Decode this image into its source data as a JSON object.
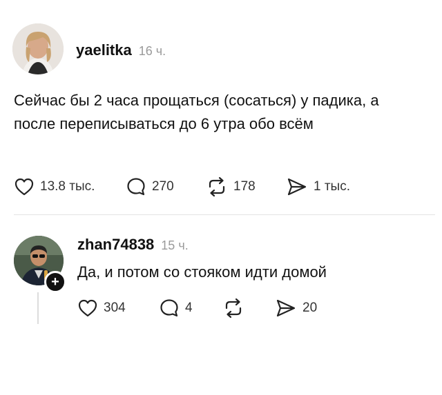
{
  "post": {
    "username": "yaelitka",
    "time": "16 ч.",
    "text": "Сейчас бы 2 часа прощаться (сосаться) у падика, а после переписываться до 6 утра обо всём",
    "likes": "13.8 тыс.",
    "comments": "270",
    "reposts": "178",
    "shares": "1 тыс."
  },
  "reply": {
    "username": "zhan74838",
    "time": "15 ч.",
    "text": "Да, и потом со стояком идти домой",
    "likes": "304",
    "comments": "4",
    "reposts": "",
    "shares": "20",
    "follow_badge": "+"
  },
  "icons": {
    "like": "heart-icon",
    "comment": "speech-bubble-icon",
    "repost": "repost-icon",
    "share": "send-icon"
  }
}
